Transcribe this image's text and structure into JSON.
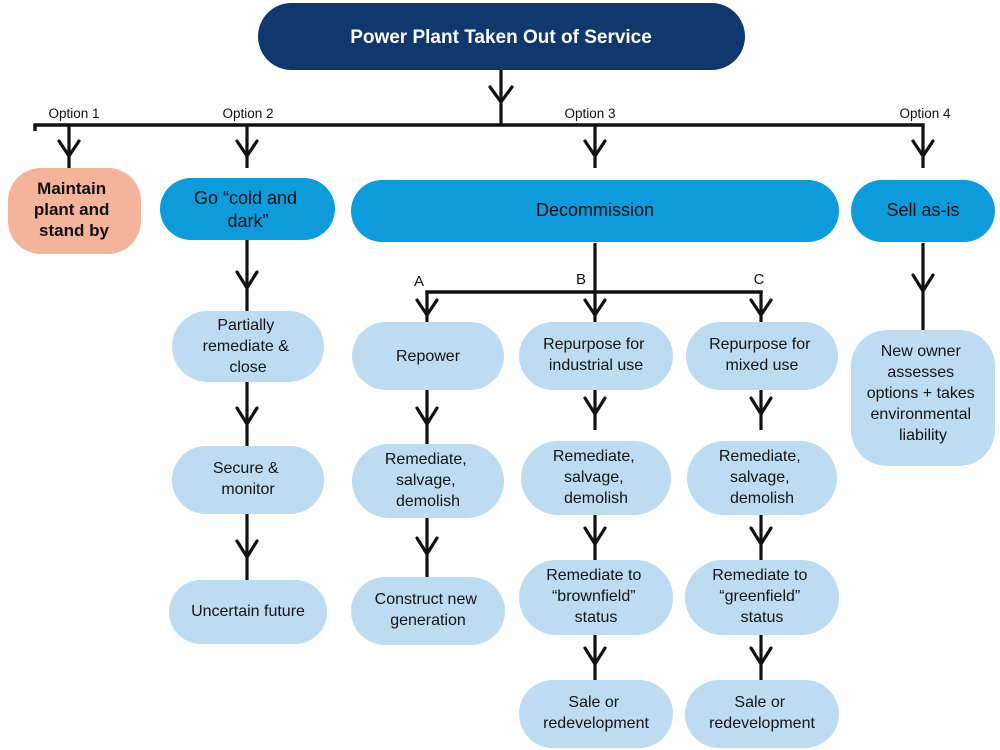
{
  "diagram": {
    "title": "Power Plant Taken Out of Service",
    "colors": {
      "root_fill": "#11376f",
      "root_text": "#ffffff",
      "option_fill": "#0d9bdb",
      "highlight_fill": "#f3b49b",
      "sub_fill": "#bddcf2",
      "line": "#111111",
      "background": "#ffffff"
    },
    "root": {
      "label": "Power Plant Taken Out of Service"
    },
    "branch_labels": {
      "option1": "Option 1",
      "option2": "Option 2",
      "option3": "Option 3",
      "option4": "Option 4",
      "sub_a": "A",
      "sub_b": "B",
      "sub_c": "C"
    },
    "options": [
      {
        "key": "option1",
        "branch": "Option 1",
        "label": "Maintain plant and stand by",
        "lines": [
          "Maintain",
          "plant and",
          "stand by"
        ],
        "style": "highlight",
        "steps": []
      },
      {
        "key": "option2",
        "branch": "Option 2",
        "label": "Go “cold and dark”",
        "lines": [
          "Go “cold and",
          "dark”"
        ],
        "style": "option",
        "steps": [
          {
            "label": "Partially remediate & close",
            "lines": [
              "Partially",
              "remediate &",
              "close"
            ]
          },
          {
            "label": "Secure & monitor",
            "lines": [
              "Secure &",
              "monitor"
            ]
          },
          {
            "label": "Uncertain future",
            "lines": [
              "Uncertain future"
            ]
          }
        ]
      },
      {
        "key": "option3",
        "branch": "Option 3",
        "label": "Decommission",
        "lines": [
          "Decommission"
        ],
        "style": "option",
        "sub_branches": [
          {
            "key": "A",
            "letter": "A",
            "steps": [
              {
                "label": "Repower",
                "lines": [
                  "Repower"
                ]
              },
              {
                "label": "Remediate, salvage, demolish",
                "lines": [
                  "Remediate,",
                  "salvage,",
                  "demolish"
                ]
              },
              {
                "label": "Construct new generation",
                "lines": [
                  "Construct new",
                  "generation"
                ]
              }
            ]
          },
          {
            "key": "B",
            "letter": "B",
            "steps": [
              {
                "label": "Repurpose for industrial use",
                "lines": [
                  "Repurpose for",
                  "industrial use"
                ]
              },
              {
                "label": "Remediate, salvage, demolish",
                "lines": [
                  "Remediate,",
                  "salvage,",
                  "demolish"
                ]
              },
              {
                "label": "Remediate to “brownfield” status",
                "lines": [
                  "Remediate to",
                  "“brownfield”",
                  "status"
                ]
              },
              {
                "label": "Sale or redevelopment",
                "lines": [
                  "Sale or",
                  "redevelopment"
                ]
              }
            ]
          },
          {
            "key": "C",
            "letter": "C",
            "steps": [
              {
                "label": "Repurpose for mixed use",
                "lines": [
                  "Repurpose for",
                  "mixed use"
                ]
              },
              {
                "label": "Remediate, salvage, demolish",
                "lines": [
                  "Remediate,",
                  "salvage,",
                  "demolish"
                ]
              },
              {
                "label": "Remediate to “greenfield” status",
                "lines": [
                  "Remediate to",
                  "“greenfield”",
                  "status"
                ]
              },
              {
                "label": "Sale or redevelopment",
                "lines": [
                  "Sale or",
                  "redevelopment"
                ]
              }
            ]
          }
        ],
        "steps": []
      },
      {
        "key": "option4",
        "branch": "Option 4",
        "label": "Sell as-is",
        "lines": [
          "Sell as-is"
        ],
        "style": "option",
        "steps": [
          {
            "label": "New owner assesses options + takes environmental liability",
            "lines": [
              "New owner",
              "assesses",
              "options + takes",
              "environmental",
              "liability"
            ]
          }
        ]
      }
    ]
  }
}
